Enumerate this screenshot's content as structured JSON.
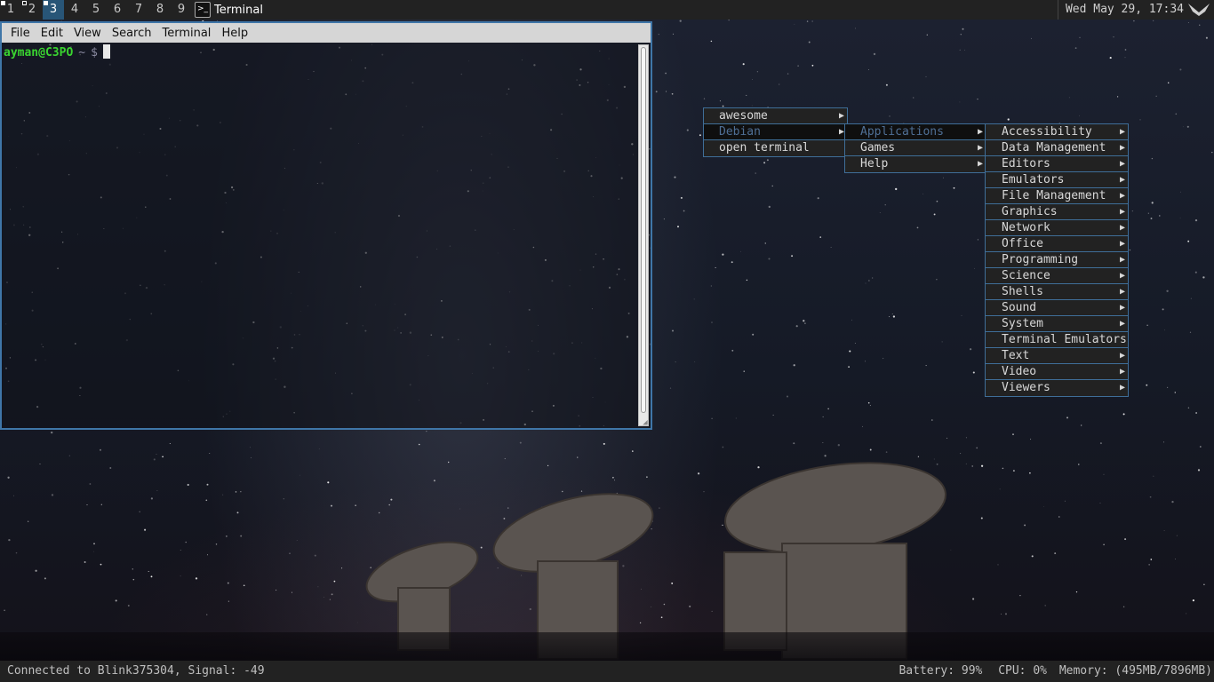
{
  "topbar": {
    "tags": [
      "1",
      "2",
      "3",
      "4",
      "5",
      "6",
      "7",
      "8",
      "9"
    ],
    "active_tag": "3",
    "task_title": "Terminal",
    "task_icon": "terminal-icon",
    "clock": "Wed May 29, 17:34",
    "launcher_icon": "awesome-launcher-icon"
  },
  "terminal": {
    "menubar": [
      "File",
      "Edit",
      "View",
      "Search",
      "Terminal",
      "Help"
    ],
    "prompt_user": "ayman@C3PO",
    "prompt_path": "~",
    "prompt_symbol": "$",
    "colors": {
      "user": "#3ad430",
      "border": "#3f76a8"
    }
  },
  "menus": {
    "level1": [
      {
        "label": "awesome",
        "submenu": true
      },
      {
        "label": "Debian",
        "submenu": true,
        "focused": true
      },
      {
        "label": "open terminal",
        "submenu": false
      }
    ],
    "level2": [
      {
        "label": "Applications",
        "submenu": true,
        "focused": true
      },
      {
        "label": "Games",
        "submenu": true
      },
      {
        "label": "Help",
        "submenu": true
      }
    ],
    "level3": [
      {
        "label": "Accessibility",
        "submenu": true
      },
      {
        "label": "Data Management",
        "submenu": true
      },
      {
        "label": "Editors",
        "submenu": true
      },
      {
        "label": "Emulators",
        "submenu": true
      },
      {
        "label": "File Management",
        "submenu": true
      },
      {
        "label": "Graphics",
        "submenu": true
      },
      {
        "label": "Network",
        "submenu": true
      },
      {
        "label": "Office",
        "submenu": true
      },
      {
        "label": "Programming",
        "submenu": true
      },
      {
        "label": "Science",
        "submenu": true
      },
      {
        "label": "Shells",
        "submenu": true
      },
      {
        "label": "Sound",
        "submenu": true
      },
      {
        "label": "System",
        "submenu": true
      },
      {
        "label": "Terminal Emulators",
        "submenu": false
      },
      {
        "label": "Text",
        "submenu": true
      },
      {
        "label": "Video",
        "submenu": true
      },
      {
        "label": "Viewers",
        "submenu": true
      }
    ],
    "colors": {
      "background": "#222222",
      "border": "#3f6e98",
      "focus_text": "#4f6f95"
    }
  },
  "statusbar": {
    "network": "Connected to Blink375304, Signal: -49",
    "battery": "Battery: 99%",
    "cpu": "CPU: 0%",
    "memory": "Memory: (495MB/7896MB)"
  }
}
